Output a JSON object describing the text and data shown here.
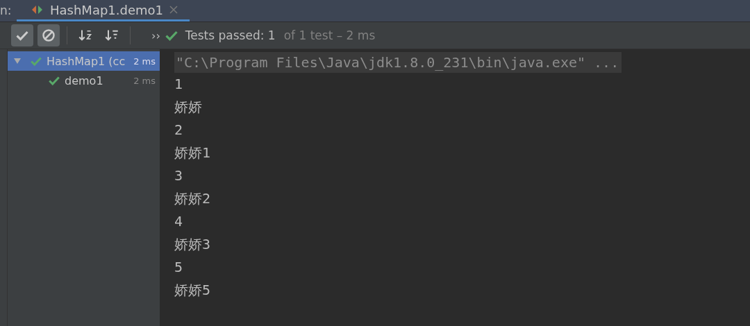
{
  "run_label": "n:",
  "tabs": [
    {
      "label": "HashMap1.demo1",
      "selected": true
    }
  ],
  "toolbar": {
    "buttons": [
      {
        "kind": "show-passed",
        "on": true
      },
      {
        "kind": "show-ignored",
        "on": true
      },
      {
        "kind": "sort-alpha",
        "on": false
      },
      {
        "kind": "sort-duration",
        "on": false
      }
    ],
    "more": "››",
    "status": {
      "passed": true,
      "main": "Tests passed: 1",
      "detail": "of 1 test – 2 ms"
    }
  },
  "tree": [
    {
      "label": "HashMap1 (cc",
      "time": "2 ms",
      "passed": true,
      "selected": true,
      "expanded": true,
      "children": [
        {
          "label": "demo1",
          "time": "2 ms",
          "passed": true,
          "selected": false
        }
      ]
    }
  ],
  "console": {
    "command": "\"C:\\Program Files\\Java\\jdk1.8.0_231\\bin\\java.exe\" ...",
    "lines": [
      "1",
      "娇娇",
      "2",
      "娇娇1",
      "3",
      "娇娇2",
      "4",
      "娇娇3",
      "5",
      "娇娇5"
    ]
  }
}
